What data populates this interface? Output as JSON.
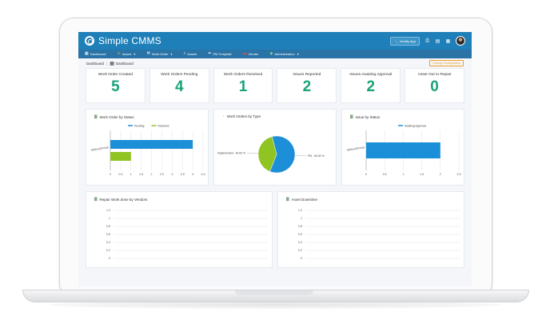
{
  "app": {
    "title": "Simple CMMS",
    "modify_label": "Modify App"
  },
  "nav": [
    {
      "label": "Dashboard",
      "icon": "dashboard-icon",
      "caret": false
    },
    {
      "label": "Issues",
      "icon": "warning-icon",
      "caret": true
    },
    {
      "label": "Work Order",
      "icon": "wrench-icon",
      "caret": true
    },
    {
      "label": "Assets",
      "icon": "search-icon",
      "caret": false
    },
    {
      "label": "PM Template",
      "icon": "tools-icon",
      "caret": false
    },
    {
      "label": "Vendor",
      "icon": "truck-icon",
      "caret": false
    },
    {
      "label": "Administration",
      "icon": "shield-icon",
      "caret": true
    }
  ],
  "breadcrumb": {
    "root": "Dashboard",
    "current": "Dashboard",
    "change_config": "Change Configuration"
  },
  "stats": [
    {
      "label": "Work Order Created",
      "value": "5"
    },
    {
      "label": "Work Orders Pending",
      "value": "4"
    },
    {
      "label": "Work Orders Resolved",
      "value": "1"
    },
    {
      "label": "Issues Reported",
      "value": "2"
    },
    {
      "label": "Issues Awaiting Approval",
      "value": "2"
    },
    {
      "label": "Asset Out to Repair",
      "value": "0"
    }
  ],
  "panels": {
    "wo_status": {
      "title": "Work Order by Status"
    },
    "wo_type": {
      "title": "Work Orders by Type"
    },
    "issue_status": {
      "title": "Issue by Status"
    },
    "repair_vendors": {
      "title": "Repair Work done by Vendors"
    },
    "asset_downtime": {
      "title": "Asset Downtime"
    }
  },
  "colors": {
    "header": "#1f7fb8",
    "nav": "#2a73a6",
    "accent": "#1aa37a",
    "blue": "#1d8fd9",
    "green": "#8fc423",
    "orange": "#f0a030"
  },
  "chart_data": [
    {
      "type": "bar",
      "title": "Work Order by Status",
      "orientation": "horizontal",
      "categories": [
        "WithoutGroup"
      ],
      "series": [
        {
          "name": "Pending",
          "values": [
            4
          ]
        },
        {
          "name": "Resolved",
          "values": [
            1
          ]
        }
      ],
      "xlim": [
        0,
        4.5
      ],
      "xticks": [
        "0",
        "0.5",
        "1",
        "1.5",
        "2",
        "2.5",
        "3",
        "3.5",
        "4",
        "4.5"
      ]
    },
    {
      "type": "pie",
      "title": "Work Orders by Type",
      "slices": [
        {
          "label": "PM",
          "value": 60,
          "display": "PM - 60.00 %"
        },
        {
          "label": "Implemented",
          "value": 40,
          "display": "Implemented - 40.00 %"
        }
      ]
    },
    {
      "type": "bar",
      "title": "Issue by Status",
      "orientation": "horizontal",
      "categories": [
        "WithoutGroup"
      ],
      "series": [
        {
          "name": "Awaiting Approval",
          "values": [
            2
          ]
        }
      ],
      "xlim": [
        0,
        2.5
      ],
      "xticks": [
        "0",
        "0.5",
        "1",
        "1.5",
        "2",
        "2.5"
      ]
    },
    {
      "type": "line",
      "title": "Repair Work done by Vendors",
      "ylim": [
        0,
        1.2
      ],
      "yticks": [
        "1.2",
        "1",
        "0.8",
        "0.6",
        "0.4",
        "0.2",
        "0"
      ],
      "series": []
    },
    {
      "type": "line",
      "title": "Asset Downtime",
      "ylim": [
        0,
        1.2
      ],
      "yticks": [
        "1.2",
        "1",
        "0.8",
        "0.6",
        "0.4",
        "0.2",
        "0"
      ],
      "series": []
    }
  ]
}
